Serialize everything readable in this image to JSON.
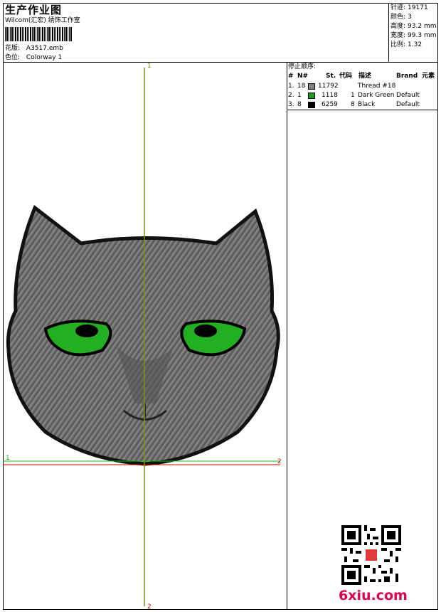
{
  "header": {
    "title": "生产作业图",
    "software": "Wilcom(汇宏) 绣饰工作室",
    "design_label": "花版:",
    "design_value": "A3517.emb",
    "colorway_label": "色位:",
    "colorway_value": "Colorway 1"
  },
  "stats": [
    {
      "label": "针迹:",
      "value": "19171"
    },
    {
      "label": "颜色:",
      "value": "3"
    },
    {
      "label": "高度:",
      "value": "93.2 mm"
    },
    {
      "label": "宽度:",
      "value": "99.3 mm"
    },
    {
      "label": "比例:",
      "value": "1.32"
    }
  ],
  "stop_sequence": {
    "title": "停止顺序:",
    "columns": [
      "#",
      "N#",
      "St.",
      "代码",
      "描述",
      "Brand",
      "元素"
    ],
    "rows": [
      {
        "idx": "1.",
        "n": "18",
        "color": "#808080",
        "st": "11792",
        "code": "",
        "desc": "Thread #18",
        "brand": ""
      },
      {
        "idx": "2.",
        "n": "1",
        "color": "#1a9a1a",
        "st": "1118",
        "code": "1",
        "desc": "Dark Green",
        "brand": "Default"
      },
      {
        "idx": "3.",
        "n": "8",
        "color": "#000000",
        "st": "6259",
        "code": "8",
        "desc": "Black",
        "brand": "Default"
      }
    ]
  },
  "guides": {
    "v_top": "1",
    "v_bottom": "2",
    "h_left": "1",
    "h_right": "2"
  },
  "watermark": {
    "site": "6xiu.com"
  },
  "colors": {
    "fur": "#6e6e6e",
    "eye": "#22b022",
    "outline": "#000000",
    "v_guide": "#8b8b00",
    "h_guide_green": "#00cc00",
    "h_guide_red": "#cc0000"
  }
}
